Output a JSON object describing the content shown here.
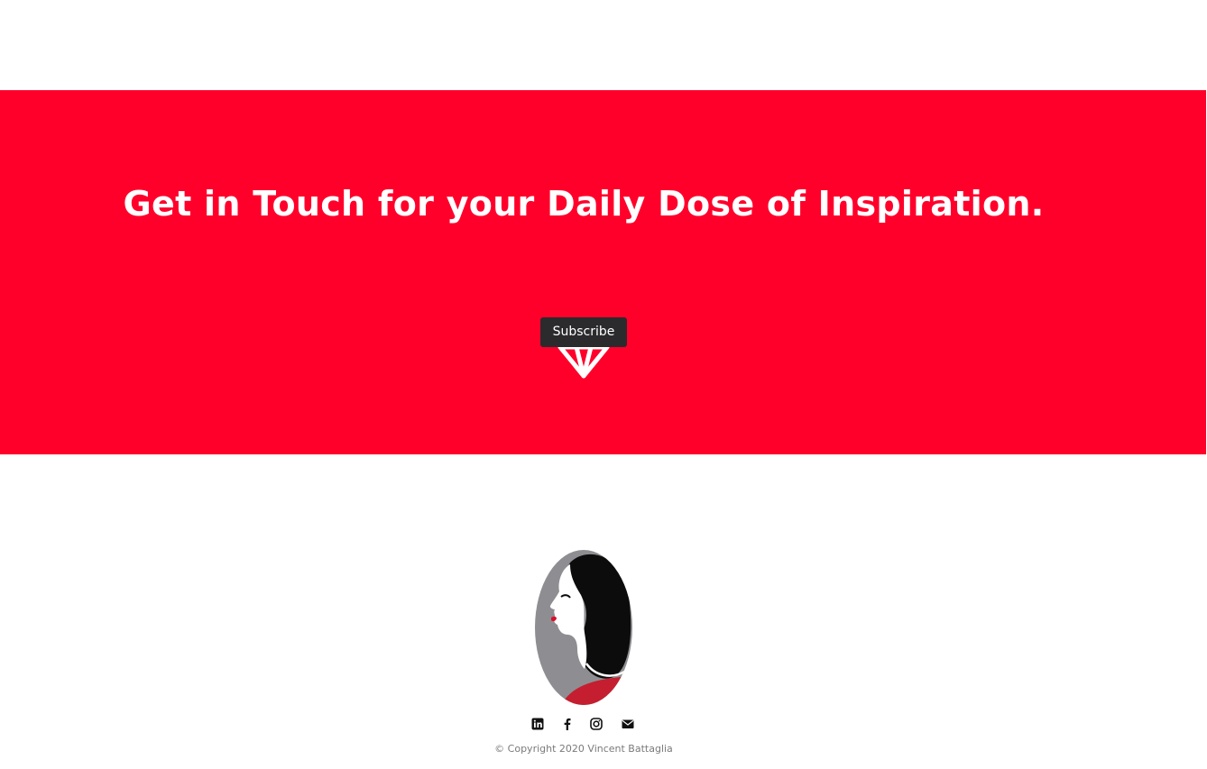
{
  "cta": {
    "heading": "Get in Touch for your Daily Dose of Inspiration.",
    "button_label": "Subscribe",
    "icon": "diamond-icon",
    "background_color": "#ff002b",
    "button_color": "#2b2b2e"
  },
  "footer": {
    "logo": "woman-profile-logo",
    "social_icons": [
      "linkedin-icon",
      "facebook-icon",
      "instagram-icon",
      "envelope-icon"
    ],
    "copyright": "© Copyright 2020 Vincent Battaglia"
  }
}
